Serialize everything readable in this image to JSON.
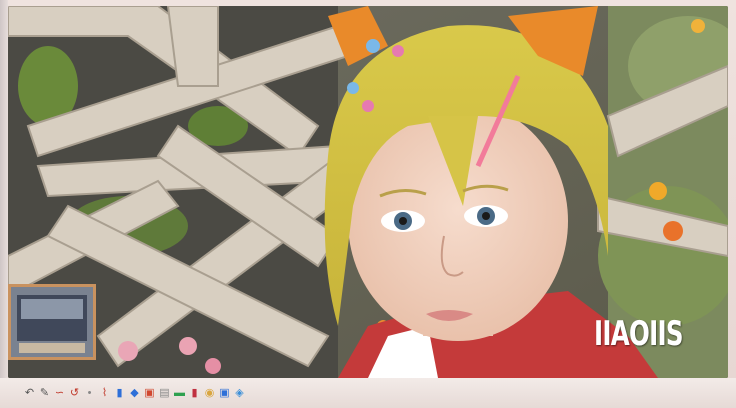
{
  "watermark": {
    "text": "IIAOIIS"
  },
  "toolbar": {
    "tools": [
      {
        "name": "undo-icon",
        "glyph": "↶",
        "color": "#555555"
      },
      {
        "name": "pencil-icon",
        "glyph": "✎",
        "color": "#555555"
      },
      {
        "name": "curve-icon",
        "glyph": "∽",
        "color": "#c0392b"
      },
      {
        "name": "loop-icon",
        "glyph": "↺",
        "color": "#c0392b"
      },
      {
        "name": "drop-icon",
        "glyph": "•",
        "color": "#888888"
      },
      {
        "name": "brush-icon",
        "glyph": "⌇",
        "color": "#c0392b"
      },
      {
        "name": "text-tool-icon",
        "glyph": "▮",
        "color": "#2e6fd8"
      },
      {
        "name": "shape-icon",
        "glyph": "◆",
        "color": "#2e6fd8"
      },
      {
        "name": "layer-icon",
        "glyph": "▣",
        "color": "#d0472f"
      },
      {
        "name": "crop-icon",
        "glyph": "▤",
        "color": "#888888"
      },
      {
        "name": "eraser-icon",
        "glyph": "▬",
        "color": "#2ea04f"
      },
      {
        "name": "fill-icon",
        "glyph": "▮",
        "color": "#c03040"
      },
      {
        "name": "palette-icon",
        "glyph": "◉",
        "color": "#d9a640"
      },
      {
        "name": "export-icon",
        "glyph": "▣",
        "color": "#2e6fd8"
      },
      {
        "name": "share-icon",
        "glyph": "◈",
        "color": "#3b8fd8"
      }
    ]
  }
}
